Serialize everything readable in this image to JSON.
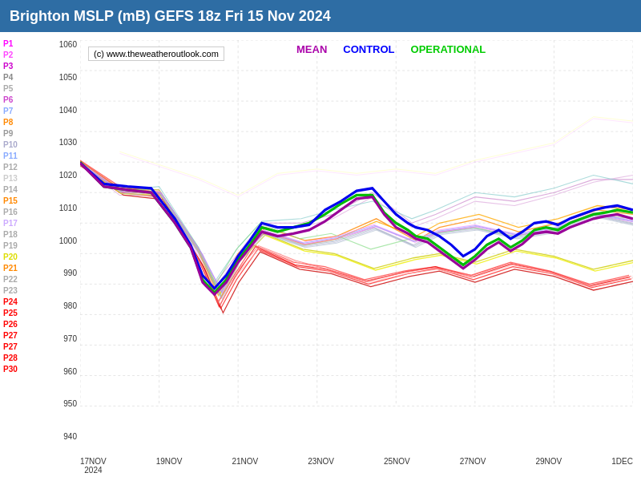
{
  "header": {
    "title": "Brighton MSLP (mB) GEFS 18z Fri 15 Nov 2024"
  },
  "watermark": "(c) www.theweatheroutlook.com",
  "legend_top": {
    "mean": "MEAN",
    "control": "CONTROL",
    "operational": "OPERATIONAL",
    "mean_color": "#aa00aa",
    "control_color": "#0000ff",
    "operational_color": "#00cc00"
  },
  "y_axis": {
    "labels": [
      "1060",
      "1050",
      "1040",
      "1030",
      "1020",
      "1010",
      "1000",
      "990",
      "980",
      "970",
      "960",
      "950",
      "940"
    ]
  },
  "x_axis": {
    "labels": [
      "17NOV\n2024",
      "19NOV",
      "21NOV",
      "23NOV",
      "25NOV",
      "27NOV",
      "29NOV",
      "1DEC"
    ]
  },
  "legend_items": [
    {
      "label": "P1",
      "color": "#ff00ff"
    },
    {
      "label": "P2",
      "color": "#ff00ff"
    },
    {
      "label": "P3",
      "color": "#cc00cc"
    },
    {
      "label": "P4",
      "color": "#aa00aa"
    },
    {
      "label": "P5",
      "color": "#aaaaaa"
    },
    {
      "label": "P6",
      "color": "#cc00cc"
    },
    {
      "label": "P7",
      "color": "#aaaaff"
    },
    {
      "label": "P8",
      "color": "#ff8800"
    },
    {
      "label": "P9",
      "color": "#aaaaaa"
    },
    {
      "label": "P10",
      "color": "#aaaaaa"
    },
    {
      "label": "P11",
      "color": "#88aaff"
    },
    {
      "label": "P12",
      "color": "#aaaaaa"
    },
    {
      "label": "P13",
      "color": "#cccccc"
    },
    {
      "label": "P14",
      "color": "#aaaaaa"
    },
    {
      "label": "P15",
      "color": "#ff8800"
    },
    {
      "label": "P16",
      "color": "#aaaaaa"
    },
    {
      "label": "P17",
      "color": "#ccaaff"
    },
    {
      "label": "P18",
      "color": "#aaaaaa"
    },
    {
      "label": "P19",
      "color": "#aaaaaa"
    },
    {
      "label": "P20",
      "color": "#ffff00"
    },
    {
      "label": "P21",
      "color": "#ff8800"
    },
    {
      "label": "P22",
      "color": "#aaaaaa"
    },
    {
      "label": "P23",
      "color": "#aaaaaa"
    },
    {
      "label": "P24",
      "color": "#ff0000"
    },
    {
      "label": "P25",
      "color": "#ff0000"
    },
    {
      "label": "P26",
      "color": "#ff0000"
    },
    {
      "label": "P27",
      "color": "#ff0000"
    },
    {
      "label": "P27",
      "color": "#ff0000"
    },
    {
      "label": "P28",
      "color": "#ff0000"
    },
    {
      "label": "P30",
      "color": "#ff0000"
    }
  ]
}
